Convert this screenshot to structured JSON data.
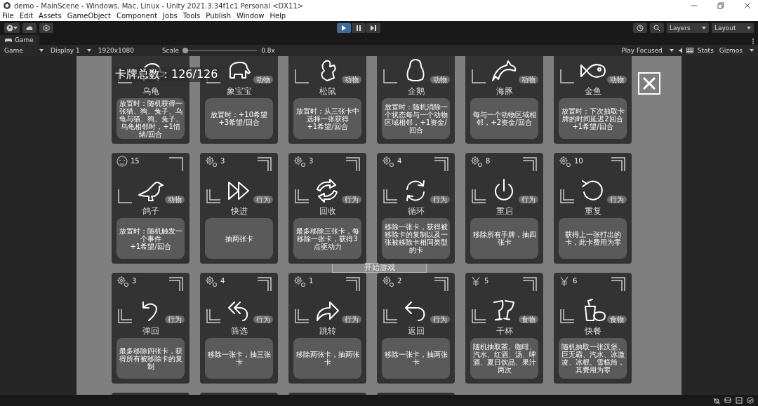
{
  "window": {
    "title": "demo - MainScene - Windows, Mac, Linux - Unity 2021.3.34f1c1 Personal <DX11>"
  },
  "menu": [
    "File",
    "Edit",
    "Assets",
    "GameObject",
    "Component",
    "Jobs",
    "Tools",
    "Publish",
    "Window",
    "Help"
  ],
  "toolbar": {
    "play": {
      "selected": true
    },
    "pause": {
      "selected": false
    },
    "step": {
      "selected": false
    },
    "layers": "Layers",
    "layout": "Layout"
  },
  "tab": {
    "label": "Game"
  },
  "game_toolbar": {
    "view": "Game",
    "display": "Display 1",
    "resolution": "1920x1080",
    "scale_label": "Scale",
    "scale": {
      "level": 0.03
    },
    "scale_value": "0.8x",
    "play_mode": "Play Focused",
    "stats": "Stats",
    "gizmos": "Gizmos"
  },
  "game": {
    "card_count": "卡牌总数：126/126",
    "start_button": "开始游戏",
    "cards": [
      {
        "kind": "animal",
        "name": "乌龟",
        "desc": "放置时：随机获得一张猫、狗、兔子、乌龟与猫、狗、兔子、乌龟相邻时，+1情绪/回合"
      },
      {
        "kind": "animal",
        "name": "象宝宝",
        "tag": "动物",
        "desc": "放置时：+10希望\n+3希望/回合"
      },
      {
        "kind": "animal",
        "name": "松鼠",
        "tag": "动物",
        "desc": "放置时：从三张卡中选择一张获得\n+1希望/回合"
      },
      {
        "kind": "animal",
        "name": "企鹅",
        "tag": "动物",
        "desc": "放置时：随机消除一个状态每与一个动物区域相邻，+1资金/回合"
      },
      {
        "kind": "animal",
        "name": "海豚",
        "tag": "动物",
        "desc": "每与一个动物区域相邻，+2资金/回合"
      },
      {
        "kind": "animal",
        "name": "金鱼",
        "tag": "动物",
        "desc": "放置时：下次抽取卡牌的时间延迟2回合\n+1希望/回合"
      },
      {
        "kind": "animal",
        "cost": "15",
        "name": "鸽子",
        "tag": "动物",
        "desc": "放置时：随机触发一个事件\n+1希望/回合"
      },
      {
        "kind": "action",
        "cost": "3",
        "name": "快进",
        "tag": "行为",
        "desc": "抽两张卡"
      },
      {
        "kind": "action",
        "cost": "3",
        "name": "回收",
        "tag": "行为",
        "desc": "最多移除三张卡，每移除一张卡，获得3点驱动力"
      },
      {
        "kind": "action",
        "cost": "4",
        "name": "循环",
        "tag": "行为",
        "desc": "移除一张卡，获得被移除卡的复制以及一张被移除卡相同类型的卡"
      },
      {
        "kind": "action",
        "cost": "8",
        "name": "重启",
        "tag": "行为",
        "desc": "移除所有手牌，抽四张卡"
      },
      {
        "kind": "action",
        "cost": "10",
        "name": "重复",
        "tag": "行为",
        "desc": "获得上一张打出的卡，此卡费用为零"
      },
      {
        "kind": "action",
        "cost": "3",
        "name": "弹回",
        "tag": "行为",
        "desc": "最多移除四张卡，获得所有被移除卡的复制"
      },
      {
        "kind": "action",
        "cost": "4",
        "name": "筛选",
        "tag": "行为",
        "desc": "移除一张卡，抽三张卡"
      },
      {
        "kind": "action",
        "cost": "1",
        "name": "跳转",
        "tag": "行为",
        "desc": "移除两张卡，抽两张卡"
      },
      {
        "kind": "action",
        "cost": "2",
        "name": "返回",
        "tag": "行为",
        "desc": "移除一张卡，抽两张卡"
      },
      {
        "kind": "food",
        "cost": "5",
        "name": "干杯",
        "tag": "食物",
        "desc": "随机抽取茶、咖啡、汽水、红酒、汤、啤酒、夏日饮品、果汁两次"
      },
      {
        "kind": "food",
        "cost": "6",
        "name": "快餐",
        "tag": "食物",
        "desc": "随机抽取一张汉堡、巨无霸、汽水、冰激凌、冰棍、雪糕筒，其费用为零"
      },
      {
        "kind": "blank"
      },
      {
        "kind": "blank"
      },
      {
        "kind": "blank"
      },
      {
        "kind": "blank"
      }
    ]
  }
}
